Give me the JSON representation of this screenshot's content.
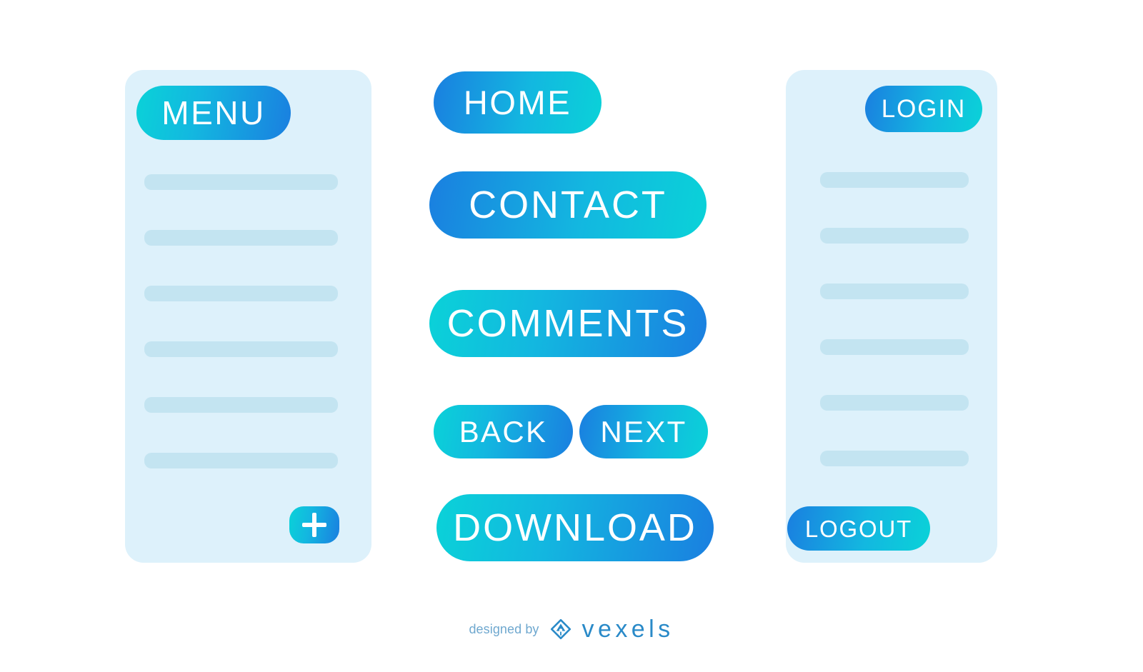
{
  "theme": {
    "page_background": "#ffffff",
    "panel_background": "#ddf1fb",
    "placeholder_bar": "#c3e4f1",
    "gradient_teal": "#0ad2d8",
    "gradient_mid": "#13b7e0",
    "gradient_blue": "#1a7fe0",
    "button_text": "#ffffff",
    "credit_text": "#6fa8cf",
    "brand_text": "#2a8ac8"
  },
  "panels": {
    "left": {
      "name": "menu-panel",
      "header_button": {
        "label": "MENU",
        "icon": "hamburger-menu-button",
        "gradient": "teal-to-blue"
      },
      "placeholder_rows": 6,
      "footer_button": {
        "label": "+",
        "icon": "plus-icon",
        "gradient": "teal-to-blue"
      }
    },
    "right": {
      "name": "account-panel",
      "header_button": {
        "label": "LOGIN",
        "gradient": "blue-to-teal"
      },
      "placeholder_rows": 6,
      "footer_button": {
        "label": "LOGOUT",
        "gradient": "blue-to-teal"
      }
    }
  },
  "center_buttons": [
    {
      "label": "HOME",
      "gradient": "blue-to-teal"
    },
    {
      "label": "CONTACT",
      "gradient": "blue-to-teal"
    },
    {
      "label": "COMMENTS",
      "gradient": "teal-to-blue"
    },
    {
      "label": "BACK",
      "gradient": "teal-to-blue"
    },
    {
      "label": "NEXT",
      "gradient": "blue-to-teal"
    },
    {
      "label": "DOWNLOAD",
      "gradient": "teal-to-blue"
    }
  ],
  "footer": {
    "credit_prefix": "designed by",
    "brand_name": "vexels",
    "logo_icon": "vexels-pen-nib-diamond-logo"
  }
}
